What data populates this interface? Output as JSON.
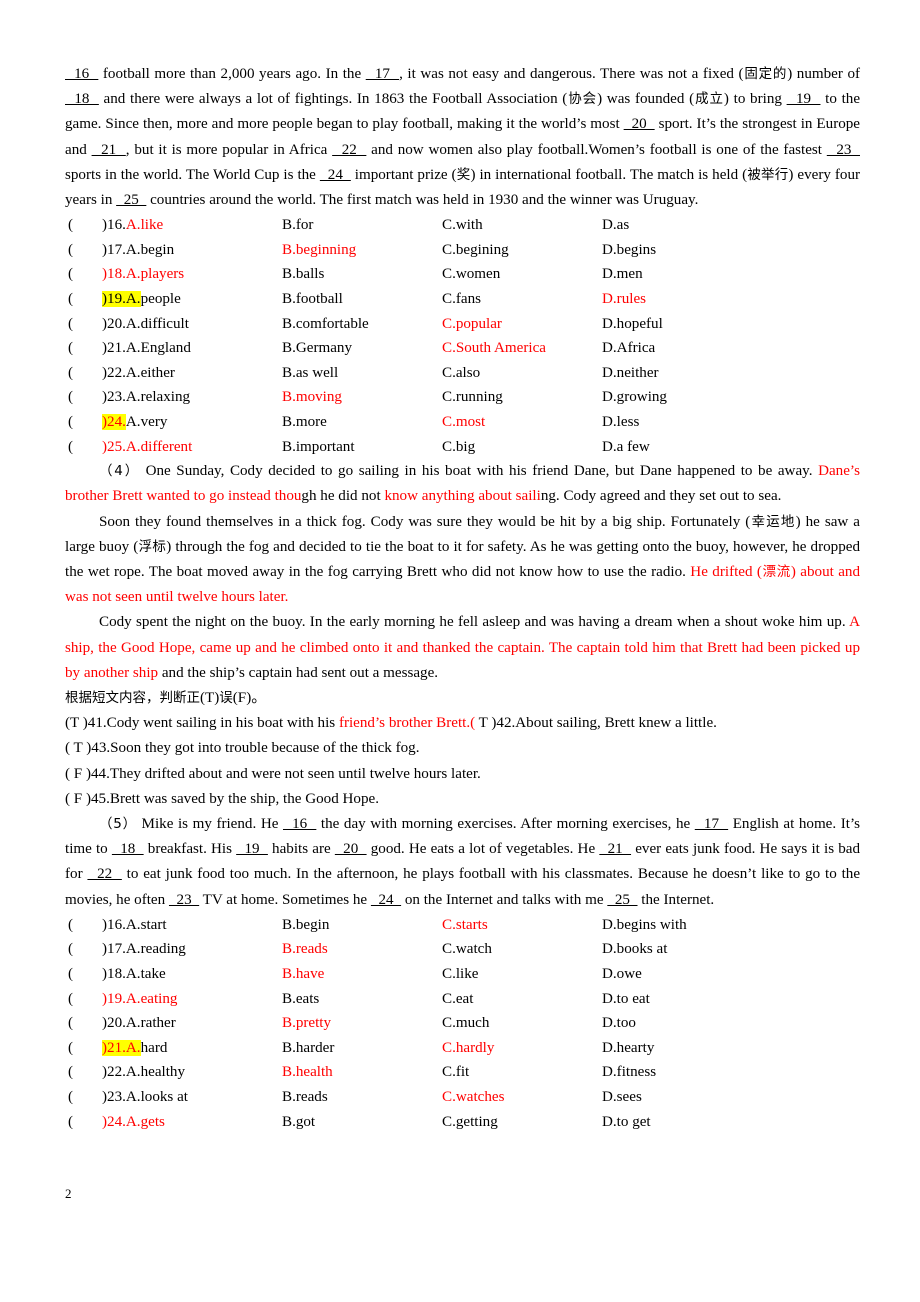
{
  "page": {
    "number": "2"
  },
  "colors": {
    "answer_red": "#ff0000",
    "highlight_yellow": "#ffff00",
    "text": "#000000"
  },
  "passage3": {
    "segments": [
      {
        "t": "16",
        "k": "blank"
      },
      {
        "t": " football more than 2,000 years ago. In the ",
        "k": "text"
      },
      {
        "t": "17",
        "k": "blank"
      },
      {
        "t": ", it was not easy and dangerous. There was not a fixed (",
        "k": "text"
      },
      {
        "t": "固定的",
        "k": "cjk"
      },
      {
        "t": ") number of ",
        "k": "text"
      },
      {
        "t": "18",
        "k": "blank"
      },
      {
        "t": " and there were always a lot of fightings. In 1863 the Football Association (",
        "k": "text"
      },
      {
        "t": "协会",
        "k": "cjk"
      },
      {
        "t": ") was founded (",
        "k": "text"
      },
      {
        "t": "成立",
        "k": "cjk"
      },
      {
        "t": ") to bring ",
        "k": "text"
      },
      {
        "t": "19",
        "k": "blank"
      },
      {
        "t": " to the game. Since then, more and more people began to play football, making it the world’s most ",
        "k": "text"
      },
      {
        "t": "20",
        "k": "blank"
      },
      {
        "t": " sport. It’s the strongest in Europe and ",
        "k": "text"
      },
      {
        "t": "21",
        "k": "blank"
      },
      {
        "t": ", but it is more popular in Africa ",
        "k": "text"
      },
      {
        "t": "22",
        "k": "blank"
      },
      {
        "t": " and now women also play football.Women’s football is one of the fastest ",
        "k": "text"
      },
      {
        "t": "23",
        "k": "blank"
      },
      {
        "t": " sports in the world. The World Cup is the ",
        "k": "text"
      },
      {
        "t": "24",
        "k": "blank"
      },
      {
        "t": " important prize (",
        "k": "text"
      },
      {
        "t": "奖",
        "k": "cjk"
      },
      {
        "t": ") in international football. The match is held (",
        "k": "text"
      },
      {
        "t": "被举行",
        "k": "cjk"
      },
      {
        "t": ") every four years in ",
        "k": "text"
      },
      {
        "t": "25",
        "k": "blank"
      },
      {
        "t": " countries around the world. The first match was held in 1930 and the winner was Uruguay.",
        "k": "text"
      }
    ]
  },
  "mc_block_1": [
    {
      "num": "16",
      "paren": "(",
      "close": ")",
      "num_red": false,
      "a_red": true,
      "highlight": "none",
      "A": "A.like",
      "B": "B.for",
      "C": "C.with",
      "D": "D.as",
      "A_red": true,
      "B_red": false,
      "C_red": false,
      "D_red": false
    },
    {
      "num": "17",
      "paren": "(",
      "close": ")",
      "num_red": false,
      "a_red": false,
      "highlight": "none",
      "A": "A.begin",
      "B": "B.beginning",
      "C": "C.begining",
      "D": "D.begins",
      "A_red": false,
      "B_red": true,
      "C_red": false,
      "D_red": false
    },
    {
      "num": "18",
      "paren": "(",
      "close": ")",
      "num_red": true,
      "a_red": true,
      "highlight": "none",
      "A": "A.players",
      "B": "B.balls",
      "C": "C.women",
      "D": "D.men",
      "A_red": true,
      "B_red": false,
      "C_red": false,
      "D_red": false
    },
    {
      "num": "19",
      "paren": "(",
      "close": ")",
      "num_red": false,
      "a_red": false,
      "highlight": "num-a",
      "A": "A.people",
      "B": "B.football",
      "C": "C.fans",
      "D": "D.rules",
      "A_red": false,
      "B_red": false,
      "C_red": false,
      "D_red": true
    },
    {
      "num": "20",
      "paren": "(",
      "close": ")",
      "num_red": false,
      "a_red": false,
      "highlight": "none",
      "A": "A.difficult",
      "B": "B.comfortable",
      "C": "C.popular",
      "D": "D.hopeful",
      "A_red": false,
      "B_red": false,
      "C_red": true,
      "D_red": false
    },
    {
      "num": "21",
      "paren": "(",
      "close": ")",
      "num_red": false,
      "a_red": false,
      "highlight": "none",
      "A": "A.England",
      "B": "B.Germany",
      "C": "C.South America",
      "D": "D.Africa",
      "A_red": false,
      "B_red": false,
      "C_red": true,
      "D_red": false
    },
    {
      "num": "22",
      "paren": "(",
      "close": ")",
      "num_red": false,
      "a_red": false,
      "highlight": "none",
      "A": "A.either",
      "B": "B.as well",
      "C": "C.also",
      "D": "D.neither",
      "A_red": false,
      "B_red": false,
      "C_red": false,
      "D_red": false
    },
    {
      "num": "23",
      "paren": "(",
      "close": ")",
      "num_red": false,
      "a_red": false,
      "highlight": "none",
      "A": "A.relaxing",
      "B": "B.moving",
      "C": "C.running",
      "D": "D.growing",
      "A_red": false,
      "B_red": true,
      "C_red": false,
      "D_red": false
    },
    {
      "num": "24",
      "paren": "(",
      "close": ")",
      "num_red": true,
      "a_red": false,
      "highlight": "num",
      "A": "A.very",
      "B": "B.more",
      "C": "C.most",
      "D": "D.less",
      "A_red": false,
      "B_red": false,
      "C_red": true,
      "D_red": false
    },
    {
      "num": "25",
      "paren": "(",
      "close": ")",
      "num_red": true,
      "a_red": true,
      "highlight": "none",
      "A": "A.different",
      "B": "B.important",
      "C": "C.big",
      "D": "D.a few",
      "A_red": true,
      "B_red": false,
      "C_red": false,
      "D_red": false
    }
  ],
  "passage4": {
    "p1": [
      {
        "t": "（4）",
        "k": "cjk"
      },
      {
        "t": " One Sunday, Cody decided to go sailing in his boat with his friend Dane, but Dane happened to be away. ",
        "k": "text"
      },
      {
        "t": "Dane’s brother Brett wanted to go instead thou",
        "k": "red"
      },
      {
        "t": "gh he did not ",
        "k": "text"
      },
      {
        "t": "know anything about saili",
        "k": "red"
      },
      {
        "t": "ng. Cody agreed and they set out to sea.",
        "k": "text"
      }
    ],
    "p2": [
      {
        "t": "Soon they found themselves in a thick fog. Cody was sure they would be hit by a big ship. Fortunately (",
        "k": "text"
      },
      {
        "t": "幸运地",
        "k": "cjk"
      },
      {
        "t": ") he saw a large buoy (",
        "k": "text"
      },
      {
        "t": "浮标",
        "k": "cjk"
      },
      {
        "t": ") through the fog and decided to tie the boat to it for safety. As he was getting onto the buoy, however, he dropped the wet rope. The boat moved away in the fog carrying Brett who did not know how to use the radio. ",
        "k": "text"
      },
      {
        "t": "He drifted (",
        "k": "red"
      },
      {
        "t": "漂流",
        "k": "cjk-red"
      },
      {
        "t": ") about and was not seen until twelve hours later.",
        "k": "red"
      }
    ],
    "p3": [
      {
        "t": "Cody spent the night on the buoy. In the early morning he fell asleep and was having a dream when a shout woke him up. ",
        "k": "text"
      },
      {
        "t": "A ship, the Good Hope, came up and he climbed onto it and thanked the captain. The captain told him that Brett had been picked up by another ship",
        "k": "red"
      },
      {
        "t": " and the ship’s captain had sent out a message.",
        "k": "text"
      }
    ],
    "instruction": [
      {
        "t": "根据短文内容，判断正",
        "k": "cjk"
      },
      {
        "t": "(T)",
        "k": "text"
      },
      {
        "t": "误",
        "k": "cjk"
      },
      {
        "t": "(F)。",
        "k": "text"
      }
    ]
  },
  "tf_questions": [
    {
      "segments": [
        {
          "t": "(T",
          "k": "text"
        },
        {
          "t": "   )41.Cody went sailing in his boat with his ",
          "k": "text"
        },
        {
          "t": "friend’s brother Brett.(",
          "k": "red"
        },
        {
          "t": "   T   )42.About sailing, Brett knew a little.",
          "k": "text"
        }
      ]
    },
    {
      "segments": [
        {
          "t": "( T",
          "k": "text"
        },
        {
          "t": "   )43.Soon they got into trouble because of the thick fog.",
          "k": "text"
        }
      ]
    },
    {
      "segments": [
        {
          "t": "( F",
          "k": "text"
        },
        {
          "t": "   )44.They drifted about and were not seen until twelve hours later.",
          "k": "text"
        }
      ]
    },
    {
      "segments": [
        {
          "t": "(  F",
          "k": "text"
        },
        {
          "t": "   )45.Brett was saved by the ship, the Good Hope.",
          "k": "text"
        }
      ]
    }
  ],
  "passage5": {
    "segments": [
      {
        "t": "（5）",
        "k": "cjk"
      },
      {
        "t": " Mike is my friend. He ",
        "k": "text"
      },
      {
        "t": "16",
        "k": "blank"
      },
      {
        "t": " the day with morning exercises. After morning exercises, he ",
        "k": "text"
      },
      {
        "t": "17",
        "k": "blank"
      },
      {
        "t": " English at home. It’s time to ",
        "k": "text"
      },
      {
        "t": "18",
        "k": "blank"
      },
      {
        "t": " breakfast. His ",
        "k": "text"
      },
      {
        "t": "19",
        "k": "blank"
      },
      {
        "t": " habits are ",
        "k": "text"
      },
      {
        "t": "20",
        "k": "blank"
      },
      {
        "t": " good. He eats a lot of vegetables. He ",
        "k": "text"
      },
      {
        "t": "21",
        "k": "blank"
      },
      {
        "t": " ever eats junk food. He says it is bad for ",
        "k": "text"
      },
      {
        "t": "22",
        "k": "blank"
      },
      {
        "t": " to eat junk food too much. In the afternoon, he plays football with his classmates. Because he doesn’t like to go to the movies, he often ",
        "k": "text"
      },
      {
        "t": "23",
        "k": "blank"
      },
      {
        "t": " TV at home. Sometimes he ",
        "k": "text"
      },
      {
        "t": "24",
        "k": "blank"
      },
      {
        "t": " on the Internet and talks with me ",
        "k": "text"
      },
      {
        "t": "25",
        "k": "blank"
      },
      {
        "t": " the Internet.",
        "k": "text"
      }
    ]
  },
  "mc_block_2": [
    {
      "num": "16",
      "paren": "(",
      "close": ")",
      "num_red": false,
      "a_red": false,
      "highlight": "none",
      "A": "A.start",
      "B": "B.begin",
      "C": "C.starts",
      "D": "D.begins with",
      "A_red": false,
      "B_red": false,
      "C_red": true,
      "D_red": false
    },
    {
      "num": "17",
      "paren": "(",
      "close": ")",
      "num_red": false,
      "a_red": false,
      "highlight": "none",
      "A": "A.reading",
      "B": "B.reads",
      "C": "C.watch",
      "D": "D.books at",
      "A_red": false,
      "B_red": true,
      "C_red": false,
      "D_red": false
    },
    {
      "num": "18",
      "paren": "(",
      "close": ")",
      "num_red": false,
      "a_red": false,
      "highlight": "none",
      "A": "A.take",
      "B": "B.have",
      "C": "C.like",
      "D": "D.owe",
      "A_red": false,
      "B_red": true,
      "C_red": false,
      "D_red": false
    },
    {
      "num": "19",
      "paren": "(",
      "close": ")",
      "num_red": true,
      "a_red": true,
      "highlight": "none",
      "A": "A.eating",
      "B": "B.eats",
      "C": "C.eat",
      "D": "D.to eat",
      "A_red": true,
      "B_red": false,
      "C_red": false,
      "D_red": false
    },
    {
      "num": "20",
      "paren": "(",
      "close": ")",
      "num_red": false,
      "a_red": false,
      "highlight": "none",
      "A": "A.rather",
      "B": "B.pretty",
      "C": "C.much",
      "D": "D.too",
      "A_red": false,
      "B_red": true,
      "C_red": false,
      "D_red": false
    },
    {
      "num": "21",
      "paren": "(",
      "close": ")",
      "num_red": true,
      "a_red": true,
      "highlight": "num-a",
      "A": "A.hard",
      "B": "B.harder",
      "C": "C.hardly",
      "D": "D.hearty",
      "A_red": false,
      "B_red": false,
      "C_red": true,
      "D_red": false
    },
    {
      "num": "22",
      "paren": "(",
      "close": ")",
      "num_red": false,
      "a_red": false,
      "highlight": "none",
      "A": "A.healthy",
      "B": "B.health",
      "C": "C.fit",
      "D": "D.fitness",
      "A_red": false,
      "B_red": true,
      "C_red": false,
      "D_red": false
    },
    {
      "num": "23",
      "paren": "(",
      "close": ")",
      "num_red": false,
      "a_red": false,
      "highlight": "none",
      "A": "A.looks at",
      "B": "B.reads",
      "C": "C.watches",
      "D": "D.sees",
      "A_red": false,
      "B_red": false,
      "C_red": true,
      "D_red": false
    },
    {
      "num": "24",
      "paren": "(",
      "close": ")",
      "num_red": true,
      "a_red": true,
      "highlight": "none",
      "A": "A.gets",
      "B": "B.got",
      "C": "C.getting",
      "D": "D.to get",
      "A_red": true,
      "B_red": false,
      "C_red": false,
      "D_red": false
    }
  ]
}
